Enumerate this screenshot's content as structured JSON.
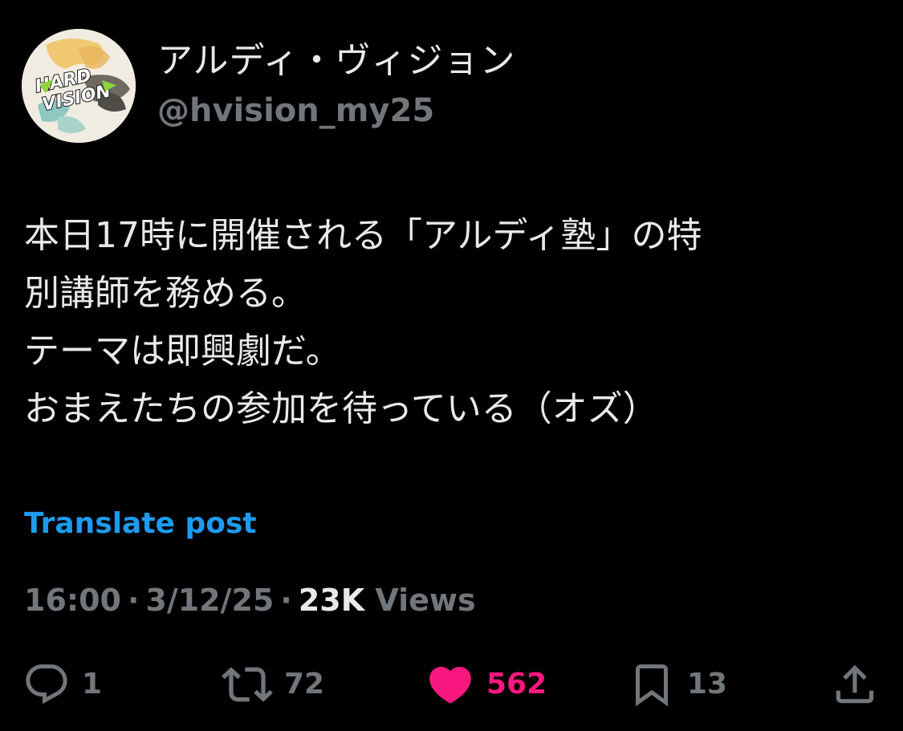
{
  "author": {
    "display_name": "アルディ・ヴィジョン",
    "handle": "@hvision_my25",
    "avatar_text": "HARD VISION"
  },
  "post": {
    "lines": [
      "本日17時に開催される「アルディ塾」の特",
      "別講師を務める。",
      "テーマは即興劇だ。",
      "おまえたちの参加を待っている（オズ）"
    ]
  },
  "translate_label": "Translate post",
  "meta": {
    "time": "16:00",
    "date": "3/12/25",
    "views_count": "23K",
    "views_label": "Views"
  },
  "actions": {
    "reply": {
      "icon": "reply-icon",
      "count": "1"
    },
    "repost": {
      "icon": "repost-icon",
      "count": "72"
    },
    "like": {
      "icon": "heart-icon",
      "count": "562",
      "color": "#f91880"
    },
    "bookmark": {
      "icon": "bookmark-icon",
      "count": "13"
    },
    "share": {
      "icon": "share-icon"
    }
  },
  "colors": {
    "background": "#000000",
    "text": "#e7e9ea",
    "muted": "#71767b",
    "link": "#1d9bf0",
    "like": "#f91880"
  }
}
